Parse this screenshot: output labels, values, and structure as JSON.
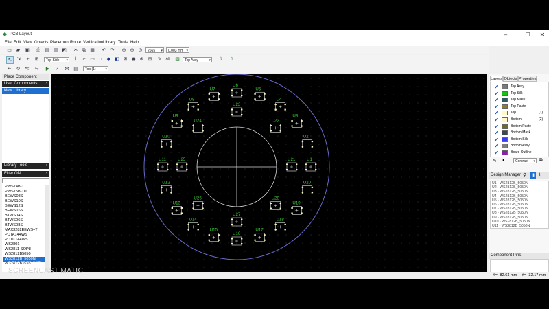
{
  "window": {
    "title": "PCB Layout",
    "minimize": "–",
    "maximize": "☐",
    "close": "✕"
  },
  "menu": [
    "File",
    "Edit",
    "View",
    "Objects",
    "Placement",
    "Route",
    "Verification",
    "Library",
    "Tools",
    "Help"
  ],
  "toolbar": {
    "zoom_value": "2665",
    "unit_value": "0.003 mm",
    "side_value": "Top Side",
    "layer_value": "Top Assy",
    "silk_label": "Alt",
    "layer2_value": "Top (1)"
  },
  "left_panel": {
    "place_component": "Place Component",
    "user_components": "User Components",
    "new_library": "New Library",
    "library_tools": "Library Tools",
    "filter_on": "Filter ON",
    "components": [
      "PWS74B-1",
      "PWS75B-1U",
      "BEWS08S",
      "BEWS10S",
      "BEWS12S",
      "BEWS16S",
      "BTWS04S",
      "BTWS06S",
      "BTWS08S",
      "MAX3282EEWS+T",
      "PDTA144WS",
      "PDTC144WS",
      "WS2801",
      "WS2811-SOP8",
      "WS2812B5050",
      "WS2812B_5050N",
      "WS2812B3535"
    ],
    "selected_component": "WS2812B_5050N"
  },
  "right_panel": {
    "tabs": [
      "Layers",
      "Objects",
      "Properties"
    ],
    "layers": [
      {
        "name": "Top Assy",
        "color": "#7a7a7a",
        "num": ""
      },
      {
        "name": "Top Silk",
        "color": "#19c219",
        "num": ""
      },
      {
        "name": "Top Mask",
        "color": "#2f5a64",
        "num": ""
      },
      {
        "name": "Top Paste",
        "color": "#8b7d2e",
        "num": ""
      },
      {
        "name": "Top",
        "color": "#fff9c8",
        "num": "(1)"
      },
      {
        "name": "Bottom",
        "color": "#fff9c8",
        "num": "(2)"
      },
      {
        "name": "Bottom Paste",
        "color": "#6b6b2a",
        "num": ""
      },
      {
        "name": "Bottom Mask",
        "color": "#3b4a4f",
        "num": ""
      },
      {
        "name": "Bottom Silk",
        "color": "#3a3af0",
        "num": ""
      },
      {
        "name": "Bottom Assy",
        "color": "#7d7d7d",
        "num": ""
      },
      {
        "name": "Board Outline",
        "color": "#8a1fa8",
        "num": ""
      }
    ],
    "contrast": "Contrast",
    "design_manager": "Design Manager",
    "dm_items": [
      "U1 - WS2812B_5050N",
      "U2 - WS2812B_5050N",
      "U3 - WS2812B_5050N",
      "U4 - WS2812B_5050N",
      "U5 - WS2812B_5050N",
      "U6 - WS2812B_5050N",
      "U7 - WS2812B_5050N",
      "U8 - WS2812B_5050N",
      "U9 - WS2812B_5050N",
      "U10 - WS2812B_5050N",
      "U11 - WS2812B_5050N"
    ],
    "component_pins": "Component Pins"
  },
  "status": {
    "x": "X= -82.61 mm",
    "y": "Y= -32.17 mm"
  },
  "watermark": {
    "small": "RECORDED WITH",
    "big": "SCREENCAST  MATIC"
  },
  "board": {
    "outer_labels": [
      "U1",
      "U2",
      "U3",
      "U4",
      "U5",
      "U6",
      "U7",
      "U8",
      "U9",
      "U10",
      "U11",
      "U12",
      "U13",
      "U14",
      "U15",
      "U16",
      "U17",
      "U18",
      "U19",
      "U20"
    ],
    "inner_labels": [
      "U21",
      "U22",
      "U23",
      "U24",
      "U25",
      "U26",
      "U27",
      "U28"
    ]
  }
}
